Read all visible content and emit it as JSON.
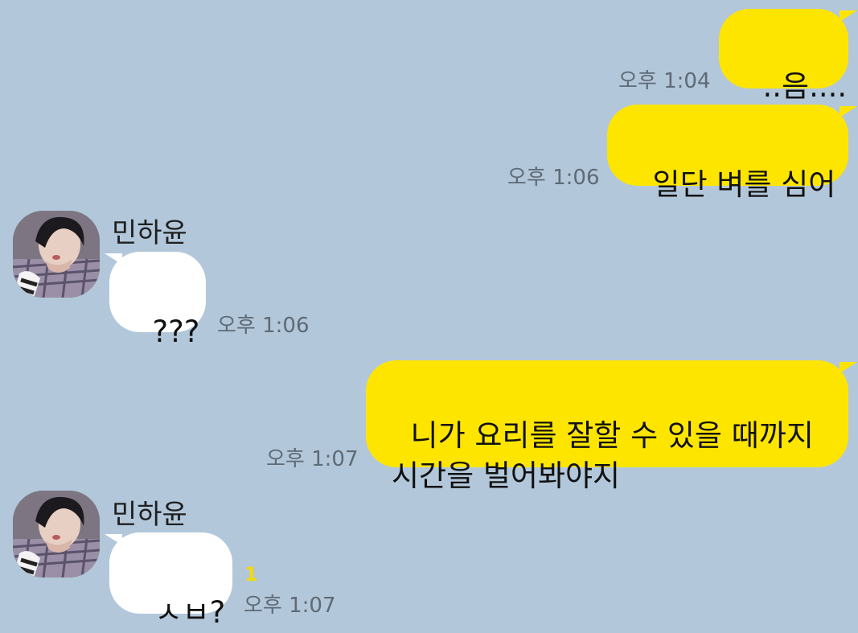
{
  "chat": {
    "messages": [
      {
        "sender": "me",
        "text": "..음....",
        "time": "오후 1:04"
      },
      {
        "sender": "me",
        "text": "일단 벼를 심어",
        "time": "오후 1:06"
      },
      {
        "sender": "민하윤",
        "name": "민하윤",
        "text": "???",
        "time": "오후 1:06"
      },
      {
        "sender": "me",
        "text": "니가 요리를 잘할 수 있을 때까지\n시간을 벌어봐야지",
        "time": "오후 1:07"
      },
      {
        "sender": "민하윤",
        "name": "민하윤",
        "text": "ㅅㅂ?",
        "time": "오후 1:07",
        "unread": "1"
      }
    ]
  },
  "colors": {
    "background": "#B2C7DA",
    "my_bubble": "#FEE500",
    "other_bubble": "#FFFFFF",
    "unread_count": "#F5D90A"
  },
  "icons": {
    "avatar": "profile-photo"
  }
}
